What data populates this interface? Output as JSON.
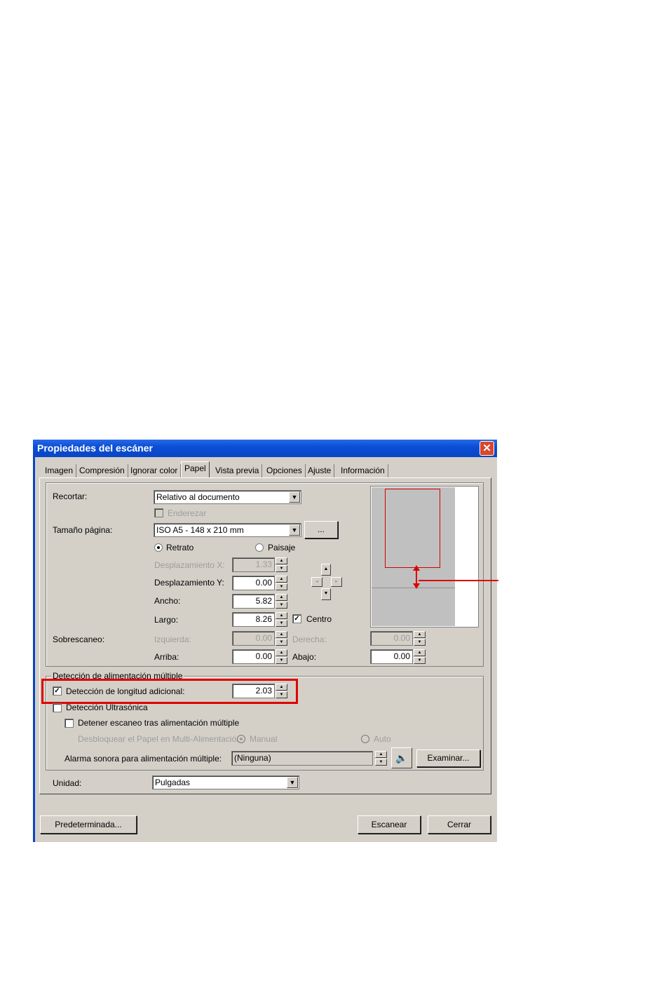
{
  "dialog": {
    "title": "Propiedades del escáner",
    "close_label": "✕"
  },
  "tabs": [
    "Imagen",
    "Compresión",
    "Ignorar color",
    "Papel",
    "Vista previa",
    "Opciones",
    "Ajuste",
    "Información"
  ],
  "active_tab": "Papel",
  "paper": {
    "recortar_label": "Recortar:",
    "recortar_value": "Relativo al documento",
    "enderezar_label": "Enderezar",
    "tamano_label": "Tamaño página:",
    "tamano_value": "ISO A5 - 148 x 210 mm",
    "browse_label": "...",
    "retrato_label": "Retrato",
    "paisaje_label": "Paisaje",
    "despx_label": "Desplazamiento X:",
    "despx_value": "1.33",
    "despy_label": "Desplazamiento Y:",
    "despy_value": "0.00",
    "ancho_label": "Ancho:",
    "ancho_value": "5.82",
    "largo_label": "Largo:",
    "largo_value": "8.26",
    "centro_label": "Centro",
    "sobrescaneo_label": "Sobrescaneo:",
    "izquierda_label": "Izquierda:",
    "izquierda_value": "0.00",
    "derecha_label": "Derecha:",
    "derecha_value": "0.00",
    "arriba_label": "Arriba:",
    "arriba_value": "0.00",
    "abajo_label": "Abajo:",
    "abajo_value": "0.00"
  },
  "multifeed": {
    "group_label": "Detección de alimentación múltiple",
    "longitud_label": "Detección de longitud adicional:",
    "longitud_value": "2.03",
    "ultrasonica_label": "Detección Ultrasónica",
    "detener_label": "Detener escaneo tras alimentación múltiple",
    "desbloquear_label": "Desbloquear el Papel en Multi-Alimentación",
    "manual_label": "Manual",
    "auto_label": "Auto",
    "alarma_label": "Alarma sonora para alimentación múltiple:",
    "alarma_value": "(Ninguna)",
    "examinar_label": "Examinar..."
  },
  "unidad": {
    "label": "Unidad:",
    "value": "Pulgadas"
  },
  "footer": {
    "predeterminada_label": "Predeterminada...",
    "escanear_label": "Escanear",
    "cerrar_label": "Cerrar"
  },
  "colors": {
    "highlight": "#e00000",
    "titlebar": "#0a4fd6",
    "dialog_bg": "#d4d0c8"
  }
}
